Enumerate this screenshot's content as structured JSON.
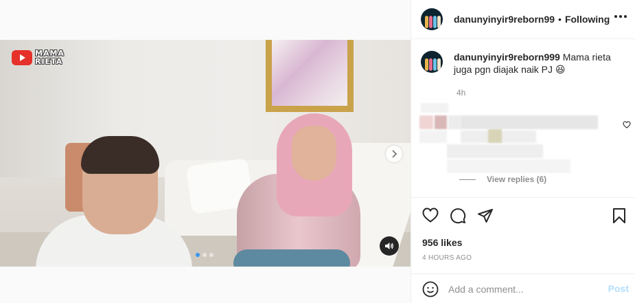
{
  "media": {
    "logo_text_line1": "MAMA",
    "logo_text_line2": "RIETA",
    "carousel_dots": 3,
    "active_dot": 0,
    "icons": [
      "youtube-icon",
      "chevron-right-icon",
      "sound-on-icon"
    ]
  },
  "header": {
    "username": "danunyinyir9reborn99",
    "separator": "•",
    "follow_status": "Following"
  },
  "caption": {
    "username": "danunyinyir9reborn999",
    "text": "Mama rieta juga pgn diajak naik PJ 😆",
    "time": "4h"
  },
  "comments": {
    "view_replies": "View replies (6)"
  },
  "actions": {
    "likes": "956 likes",
    "posted_ago": "4 HOURS AGO"
  },
  "comment_box": {
    "placeholder": "Add a comment...",
    "post_label": "Post"
  },
  "colors": {
    "text_primary": "#262626",
    "text_secondary": "#8e8e8e",
    "border": "#efefef",
    "post_disabled": "#b2dffc",
    "dot_active": "#3897f0"
  }
}
